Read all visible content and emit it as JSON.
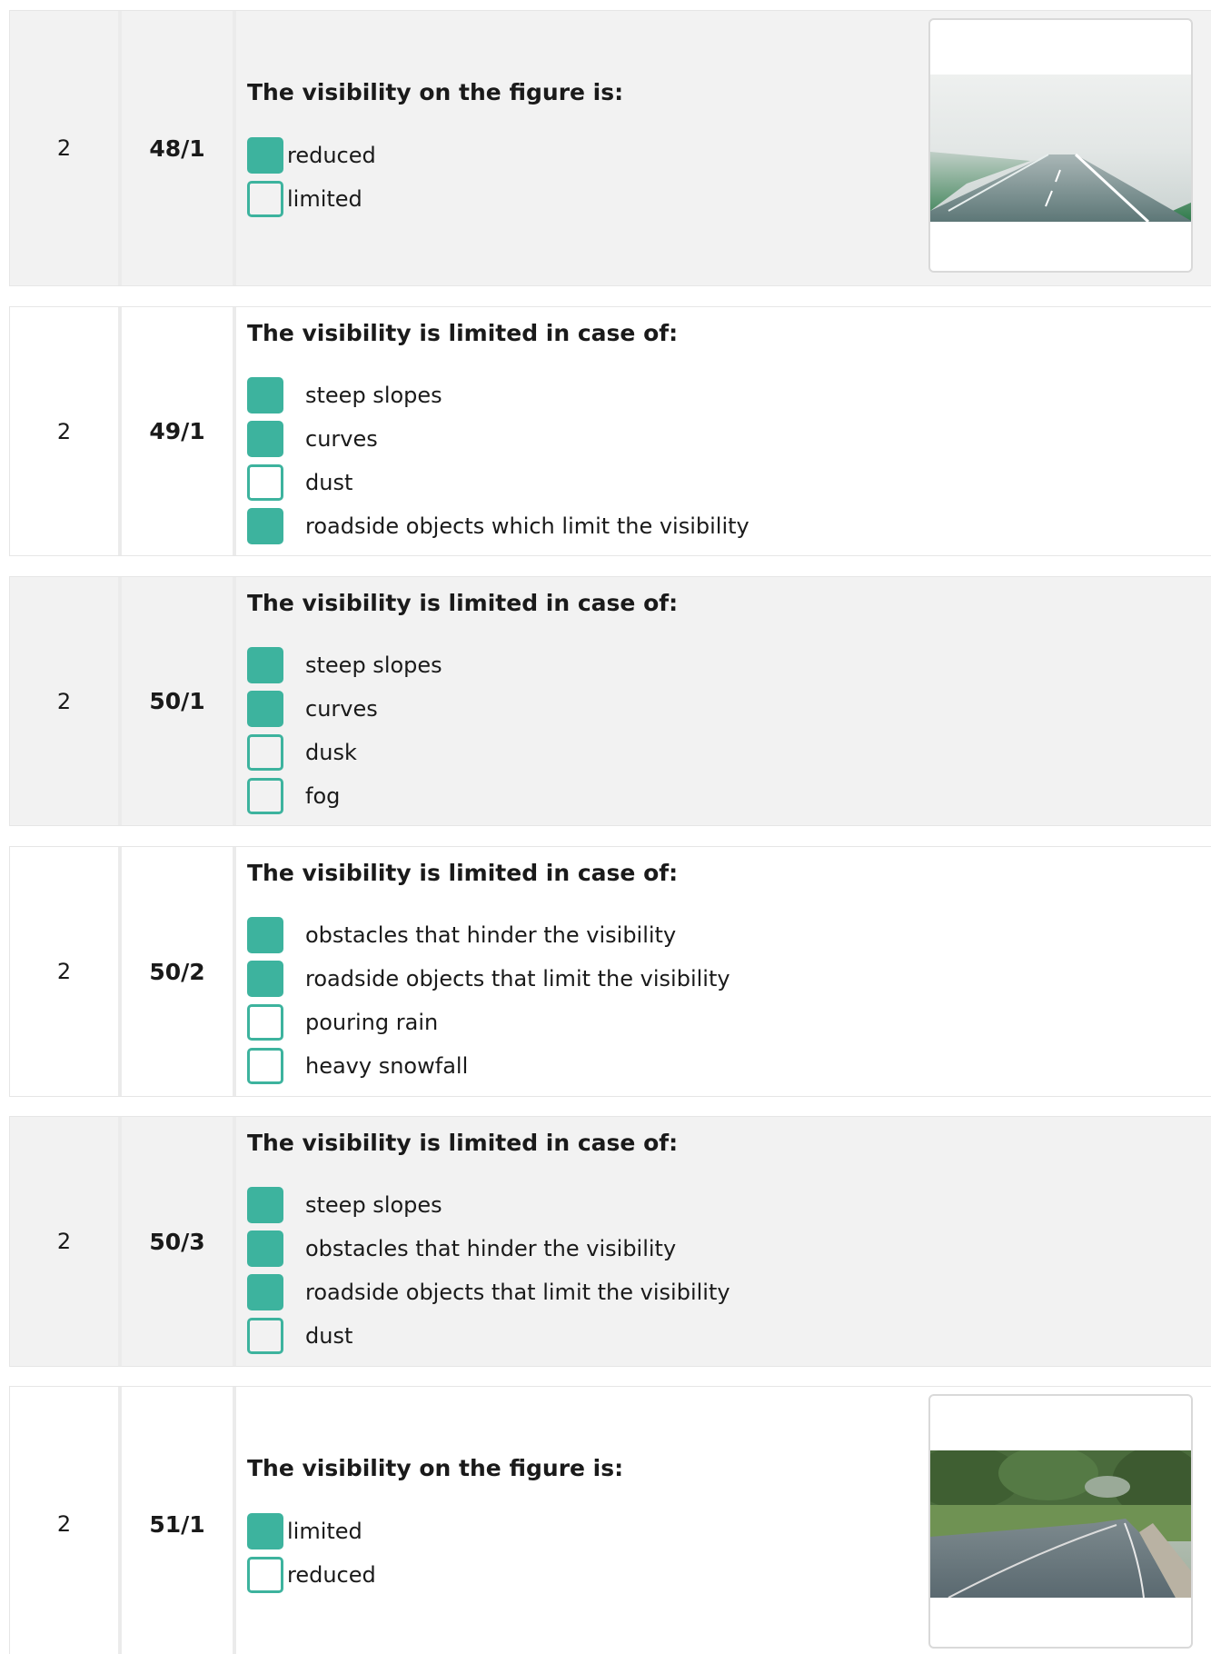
{
  "questions": [
    {
      "points": "2",
      "id": "48/1",
      "text": "The visibility on the figure is:",
      "options": [
        {
          "label": "reduced",
          "checked": true
        },
        {
          "label": "limited",
          "checked": false
        }
      ],
      "image": "foggy-road-photo"
    },
    {
      "points": "2",
      "id": "49/1",
      "text": "The visibility is limited in case of:",
      "options": [
        {
          "label": "steep slopes",
          "checked": true
        },
        {
          "label": "curves",
          "checked": true
        },
        {
          "label": "dust",
          "checked": false
        },
        {
          "label": "roadside objects which limit the visibility",
          "checked": true
        }
      ]
    },
    {
      "points": "2",
      "id": "50/1",
      "text": "The visibility is limited in case of:",
      "options": [
        {
          "label": "steep slopes",
          "checked": true
        },
        {
          "label": "curves",
          "checked": true
        },
        {
          "label": "dusk",
          "checked": false
        },
        {
          "label": "fog",
          "checked": false
        }
      ]
    },
    {
      "points": "2",
      "id": "50/2",
      "text": "The visibility is limited in case of:",
      "options": [
        {
          "label": "obstacles that hinder the visibility",
          "checked": true
        },
        {
          "label": "roadside objects that limit the visibility",
          "checked": true
        },
        {
          "label": "pouring rain",
          "checked": false
        },
        {
          "label": "heavy snowfall",
          "checked": false
        }
      ]
    },
    {
      "points": "2",
      "id": "50/3",
      "text": "The visibility is limited in case of:",
      "options": [
        {
          "label": "steep slopes",
          "checked": true
        },
        {
          "label": "obstacles that hinder the visibility",
          "checked": true
        },
        {
          "label": "roadside objects that limit the visibility",
          "checked": true
        },
        {
          "label": "dust",
          "checked": false
        }
      ]
    },
    {
      "points": "2",
      "id": "51/1",
      "text": "The visibility on the figure is:",
      "options": [
        {
          "label": "limited",
          "checked": true
        },
        {
          "label": "reduced",
          "checked": false
        }
      ],
      "image": "curved-road-photo"
    }
  ],
  "colors": {
    "checkbox": "#3db39e",
    "row_grey": "#f2f2f2",
    "divider": "#ebebeb"
  }
}
